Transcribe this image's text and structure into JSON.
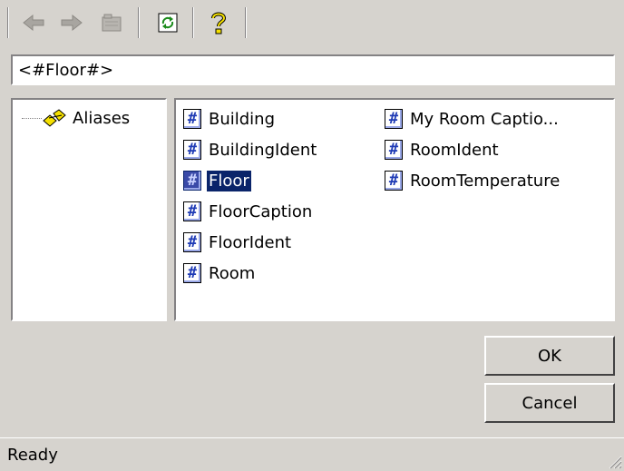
{
  "toolbar": {
    "buttons": [
      {
        "name": "back-arrow-icon",
        "enabled": false
      },
      {
        "name": "forward-arrow-icon",
        "enabled": false
      },
      {
        "name": "folder-icon",
        "enabled": false
      },
      {
        "name": "refresh-icon",
        "enabled": true
      },
      {
        "name": "help-icon",
        "enabled": true
      }
    ]
  },
  "expression_field": {
    "value": "<#Floor#>"
  },
  "tree": {
    "root_label": "Aliases",
    "icon": "aliases-icon"
  },
  "list": {
    "items": [
      {
        "label": "Building",
        "selected": false
      },
      {
        "label": "BuildingIdent",
        "selected": false
      },
      {
        "label": "Floor",
        "selected": true
      },
      {
        "label": "FloorCaption",
        "selected": false
      },
      {
        "label": "FloorIdent",
        "selected": false
      },
      {
        "label": "Room",
        "selected": false
      },
      {
        "label": "My Room Captio...",
        "selected": false
      },
      {
        "label": "RoomIdent",
        "selected": false
      },
      {
        "label": "RoomTemperature",
        "selected": false
      }
    ]
  },
  "buttons": {
    "ok": "OK",
    "cancel": "Cancel"
  },
  "status": {
    "text": "Ready"
  },
  "colors": {
    "face": "#d6d3ce",
    "selection": "#0a246a",
    "icon_blue": "#1f3bb5"
  }
}
